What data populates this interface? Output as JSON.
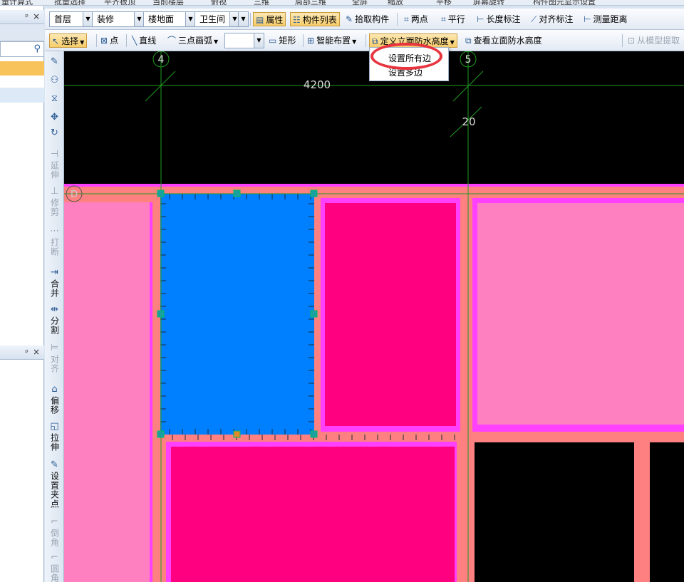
{
  "top_strip": [
    "量计算式",
    "批量选择",
    "平齐板顶",
    "当前楼层",
    "俯视",
    "三维",
    "局部三维",
    "全屏",
    "缩放",
    "平移",
    "屏幕旋转",
    "构件图元显示设置"
  ],
  "left_panel": {
    "pane1": {
      "pin": "ᵖ",
      "close": "×"
    },
    "pane2": {
      "pin": "ᵖ",
      "close": "×"
    },
    "search_icon": "search-icon"
  },
  "toolbar1": {
    "floor": "首层",
    "category": "装修",
    "subcategory": "楼地面",
    "component": "卫生间",
    "component_value": "",
    "attributes": "属性",
    "component_list": "构件列表",
    "pick_component": "拾取构件",
    "two_points": "两点",
    "parallel": "平行",
    "length_dim": "长度标注",
    "aligned_dim": "对齐标注",
    "measure_distance": "测量距离"
  },
  "toolbar2": {
    "select": "选择",
    "point": "点",
    "line": "直线",
    "arc": "三点画弧",
    "arc_value": "",
    "rectangle": "矩形",
    "smart_layout": "智能布置",
    "define_waterproof": "定义立面防水高度",
    "view_waterproof": "查看立面防水高度",
    "extract_from_model": "从模型提取"
  },
  "dropdown": {
    "set_all_edges": "设置所有边",
    "set_multiple_edges": "设置多边"
  },
  "vertical_tools": [
    {
      "label": "",
      "icon": "brush-icon"
    },
    {
      "label": "",
      "icon": "copy-icon"
    },
    {
      "label": "",
      "icon": "mirror-icon"
    },
    {
      "label": "",
      "icon": "move-icon"
    },
    {
      "label": "",
      "icon": "rotate-icon"
    },
    {
      "label": "延伸",
      "icon": "extend-icon"
    },
    {
      "label": "修剪",
      "icon": "trim-icon"
    },
    {
      "label": "打断",
      "icon": "break-icon"
    },
    {
      "label": "合并",
      "icon": "merge-icon"
    },
    {
      "label": "分割",
      "icon": "split-icon"
    },
    {
      "label": "对齐",
      "icon": "align-icon"
    },
    {
      "label": "偏移",
      "icon": "offset-icon"
    },
    {
      "label": "拉伸",
      "icon": "stretch-icon"
    },
    {
      "label": "设置夹点",
      "icon": "grip-icon"
    },
    {
      "label": "倒角",
      "icon": "chamfer-icon"
    },
    {
      "label": "圆角",
      "icon": "fillet-icon"
    }
  ],
  "canvas": {
    "axis_4": "4",
    "axis_5": "5",
    "axis_d": "D",
    "dim_span": "4200",
    "dim_offset": "20",
    "colors": {
      "background": "#000000",
      "grid": "#1f9c1f",
      "wall": "#ff8080",
      "outline": "#ff40ff",
      "room_light": "#ff80c0",
      "room_hot": "#ff0080",
      "room_selected": "#0080ff"
    }
  }
}
